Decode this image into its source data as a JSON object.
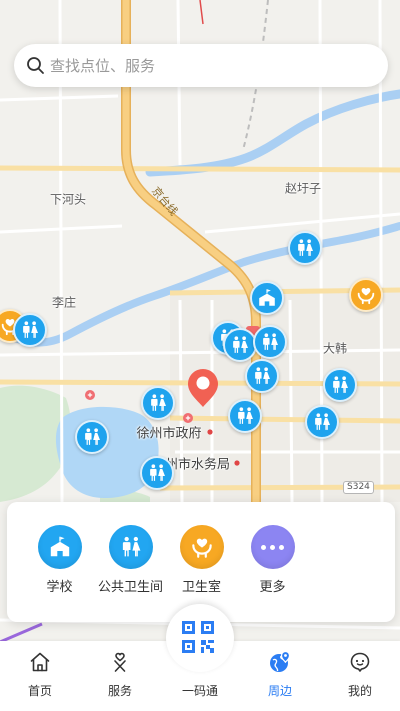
{
  "search": {
    "placeholder": "查找点位、服务",
    "icon": "search-icon"
  },
  "map": {
    "place_labels": [
      "下河头",
      "赵圩子",
      "京台线",
      "李庄",
      "大韩",
      "徐州市政府",
      "徐州市水务局"
    ],
    "road_badge": "S324"
  },
  "categories": [
    {
      "label": "学校",
      "icon": "school-icon",
      "color": "#22a6f1"
    },
    {
      "label": "公共卫生间",
      "icon": "restroom-icon",
      "color": "#22a6f1"
    },
    {
      "label": "卫生室",
      "icon": "clinic-icon",
      "color": "#f7a823"
    },
    {
      "label": "更多",
      "icon": "more-icon",
      "color": "#8c85f2"
    }
  ],
  "tabs": [
    {
      "label": "首页",
      "icon": "home-icon",
      "active": false
    },
    {
      "label": "服务",
      "icon": "service-icon",
      "active": false
    },
    {
      "label": "一码通",
      "icon": "qr-code-icon",
      "active": false
    },
    {
      "label": "周边",
      "icon": "nearby-icon",
      "active": true
    },
    {
      "label": "我的",
      "icon": "profile-icon",
      "active": false
    }
  ],
  "colors": {
    "accent": "#2b7df3",
    "marker_blue": "#1fa3ee",
    "orange": "#f7a823",
    "pin_red": "#f05a4b"
  }
}
